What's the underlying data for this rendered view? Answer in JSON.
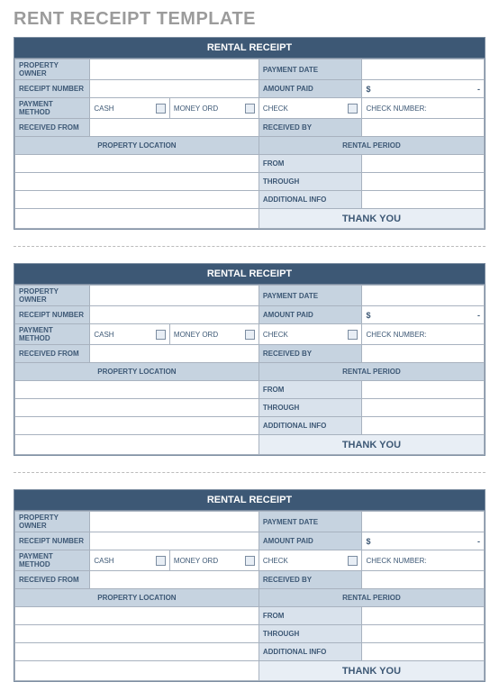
{
  "page_title": "RENT RECEIPT TEMPLATE",
  "receipts": [
    {
      "header": "RENTAL RECEIPT",
      "labels": {
        "property_owner": "PROPERTY OWNER",
        "payment_date": "PAYMENT DATE",
        "receipt_number": "RECEIPT NUMBER",
        "amount_paid": "AMOUNT PAID",
        "payment_method": "PAYMENT METHOD",
        "received_from": "RECEIVED FROM",
        "received_by": "RECEIVED BY",
        "property_location": "PROPERTY LOCATION",
        "rental_period": "RENTAL PERIOD",
        "from": "FROM",
        "through": "THROUGH",
        "additional_info": "ADDITIONAL INFO",
        "thank_you": "THANK YOU"
      },
      "payment_methods": {
        "cash": "CASH",
        "money_ord": "MONEY ORD",
        "check": "CHECK",
        "check_number": "CHECK NUMBER:"
      },
      "amount": {
        "currency": "$",
        "dash": "-"
      }
    },
    {
      "header": "RENTAL RECEIPT",
      "labels": {
        "property_owner": "PROPERTY OWNER",
        "payment_date": "PAYMENT DATE",
        "receipt_number": "RECEIPT NUMBER",
        "amount_paid": "AMOUNT PAID",
        "payment_method": "PAYMENT METHOD",
        "received_from": "RECEIVED FROM",
        "received_by": "RECEIVED BY",
        "property_location": "PROPERTY LOCATION",
        "rental_period": "RENTAL PERIOD",
        "from": "FROM",
        "through": "THROUGH",
        "additional_info": "ADDITIONAL INFO",
        "thank_you": "THANK YOU"
      },
      "payment_methods": {
        "cash": "CASH",
        "money_ord": "MONEY ORD",
        "check": "CHECK",
        "check_number": "CHECK NUMBER:"
      },
      "amount": {
        "currency": "$",
        "dash": "-"
      }
    },
    {
      "header": "RENTAL RECEIPT",
      "labels": {
        "property_owner": "PROPERTY OWNER",
        "payment_date": "PAYMENT DATE",
        "receipt_number": "RECEIPT NUMBER",
        "amount_paid": "AMOUNT PAID",
        "payment_method": "PAYMENT METHOD",
        "received_from": "RECEIVED FROM",
        "received_by": "RECEIVED BY",
        "property_location": "PROPERTY LOCATION",
        "rental_period": "RENTAL PERIOD",
        "from": "FROM",
        "through": "THROUGH",
        "additional_info": "ADDITIONAL INFO",
        "thank_you": "THANK YOU"
      },
      "payment_methods": {
        "cash": "CASH",
        "money_ord": "MONEY ORD",
        "check": "CHECK",
        "check_number": "CHECK NUMBER:"
      },
      "amount": {
        "currency": "$",
        "dash": "-"
      }
    }
  ]
}
